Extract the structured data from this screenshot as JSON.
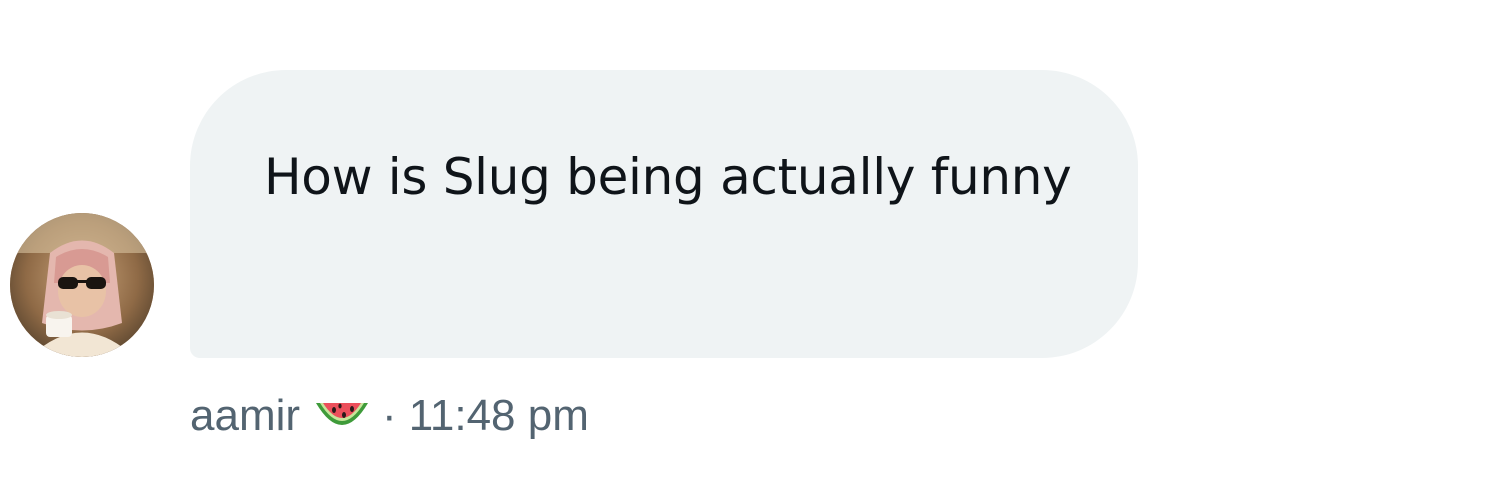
{
  "message": {
    "text": "How is Slug being actually funny",
    "bubble_color": "#eff3f4",
    "text_color": "#0f1419"
  },
  "meta": {
    "sender": "aamir",
    "sender_emoji_icon": "watermelon-icon",
    "separator": "·",
    "time": "11:48 pm",
    "meta_color": "#536471"
  },
  "avatar": {
    "icon": "user-avatar-photo"
  }
}
